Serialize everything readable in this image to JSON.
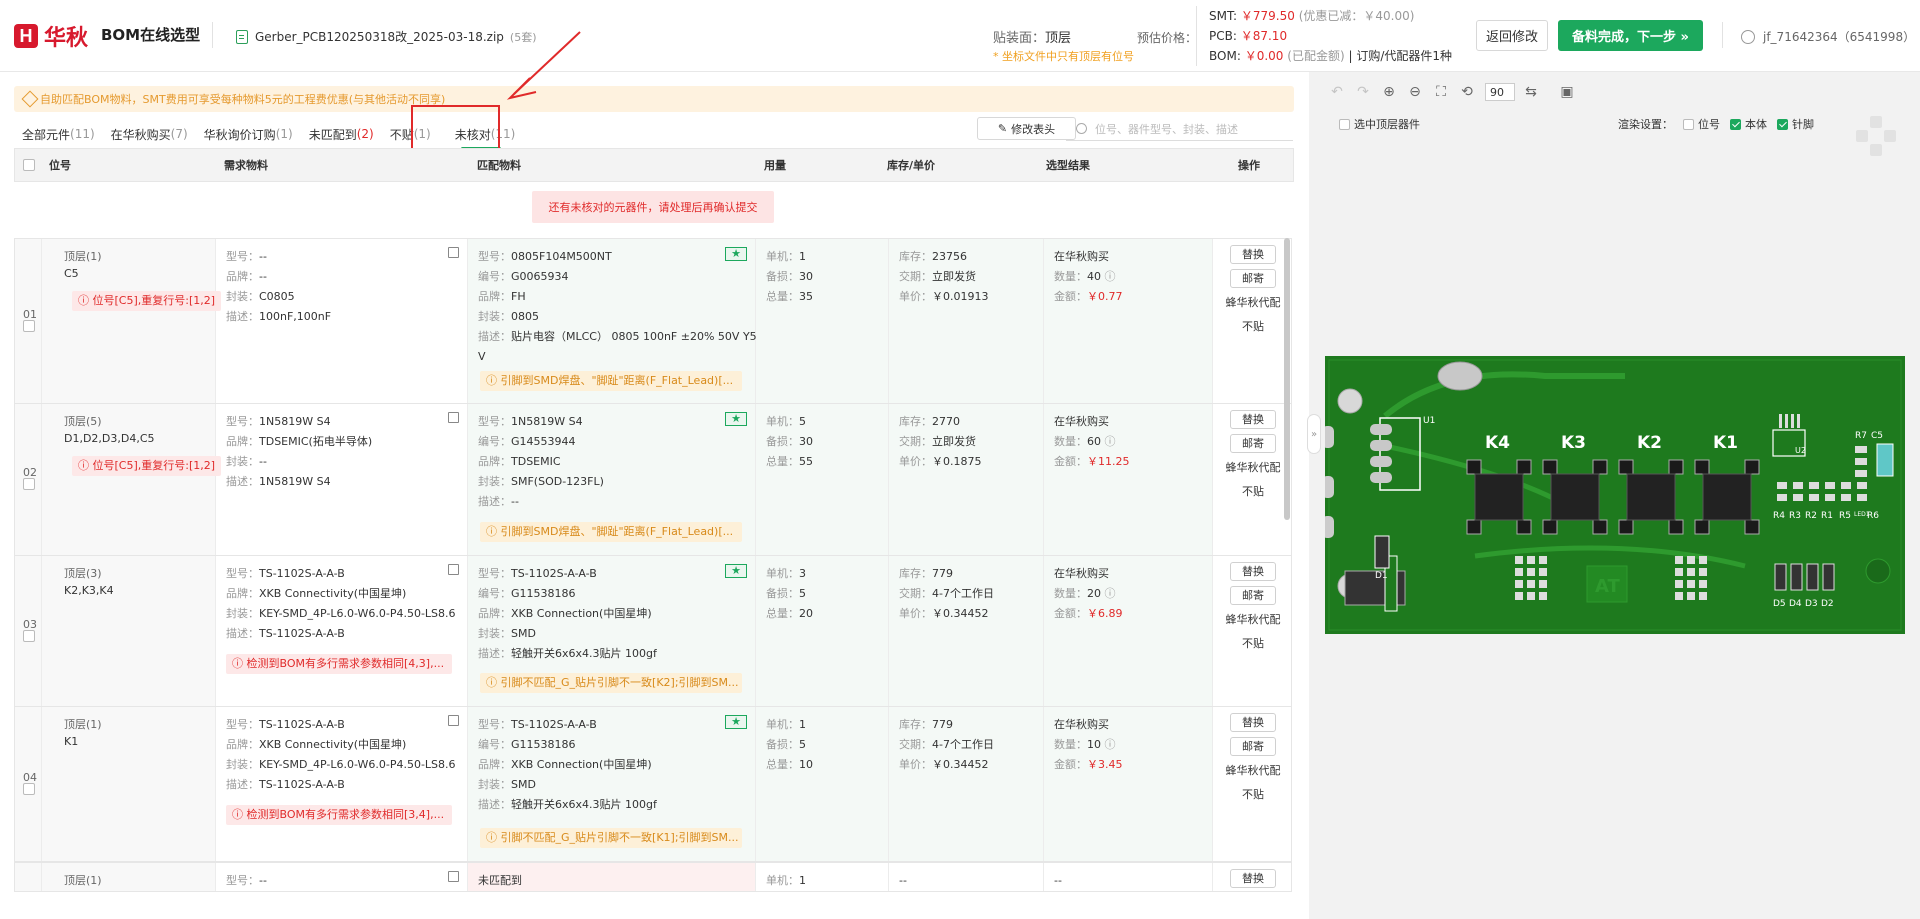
{
  "header": {
    "logo_mark": "H",
    "logo_text": "华秋",
    "app_title": "BOM在线选型",
    "file_name": "Gerber_PCB120250318改_2025-03-18.zip",
    "file_count": "(5套)",
    "side_label": "贴装面：",
    "side_value": "顶层",
    "side_note": "* 坐标文件中只有顶层有位号",
    "estimate_label": "预估价格：",
    "price_smt": "SMT:",
    "price_smt_value": "￥779.50",
    "price_smt_note": "(优惠已减：￥40.00)",
    "price_pcb": "PCB:",
    "price_pcb_value": "￥87.10",
    "price_bom": "BOM:",
    "price_bom_value": "￥0.00",
    "price_bom_note": "(已配金额)",
    "price_bom_extra": "| 订购/代配器件1种",
    "back_button": "返回修改",
    "next_button": "备料完成，下一步 »",
    "user": "jf_71642364（6541998）"
  },
  "notice": "自助匹配BOM物料，SMT费用可享受每种物料5元的工程费优惠(与其他活动不同享)",
  "tabs": [
    {
      "label": "全部元件",
      "count": "(11)"
    },
    {
      "label": "在华秋购买",
      "count": "(7)"
    },
    {
      "label": "华秋询价订购",
      "count": "(1)"
    },
    {
      "label": "未匹配到",
      "count": "(2)"
    },
    {
      "label": "不贴",
      "count": "(1)"
    },
    {
      "label": "未核对",
      "count": "(11)"
    }
  ],
  "edit_header_button": "修改表头",
  "search_placeholder": "位号、器件型号、封装、描述",
  "table_headers": {
    "pos": "位号",
    "req": "需求物料",
    "match": "匹配物料",
    "qty": "用量",
    "stock": "库存/单价",
    "result": "选型结果",
    "op": "操作"
  },
  "unchecked_warning": "还有未核对的元器件，请处理后再确认提交",
  "labels": {
    "model": "型号：",
    "brand": "品牌：",
    "package": "封装：",
    "desc": "描述：",
    "code": "编号：",
    "unit": "单机：",
    "spare": "备损：",
    "total": "总量：",
    "stock": "库存：",
    "lead": "交期：",
    "price": "单价：",
    "count": "数量：",
    "amount": "金额："
  },
  "ops": {
    "replace": "替换",
    "mail": "邮寄",
    "agent": "蜂华秋代配",
    "skip": "不贴"
  },
  "rows": [
    {
      "idx": "01",
      "layer": "顶层(1)",
      "designators": "C5",
      "error": "位号[C5],重复行号:[1,2]",
      "req_model": "--",
      "req_brand": "--",
      "req_package": "C0805",
      "req_desc": "100nF,100nF",
      "m_model": "0805F104M500NT",
      "m_code": "G0065934",
      "m_brand": "FH",
      "m_package": "0805",
      "m_desc": "贴片电容（MLCC） 0805 100nF ±20% 50V Y5",
      "m_desc2": "V",
      "pin_warn": "引脚到SMD焊盘、\"脚趾\"距离(F_Flat_Lead)[...",
      "unit": "1",
      "spare": "30",
      "total": "35",
      "stock": "23756",
      "lead": "立即发货",
      "price": "￥0.01913",
      "result": "在华秋购买",
      "count": "40",
      "amount": "￥0.77"
    },
    {
      "idx": "02",
      "layer": "顶层(5)",
      "designators": "D1,D2,D3,D4,C5",
      "error": "位号[C5],重复行号:[1,2]",
      "req_model": "1N5819W S4",
      "req_brand": "TDSEMIC(拓电半导体)",
      "req_package": "--",
      "req_desc": "1N5819W S4",
      "m_model": "1N5819W S4",
      "m_code": "G14553944",
      "m_brand": "TDSEMIC",
      "m_package": "SMF(SOD-123FL)",
      "m_desc": "--",
      "m_desc2": "",
      "pin_warn": "引脚到SMD焊盘、\"脚趾\"距离(F_Flat_Lead)[...",
      "unit": "5",
      "spare": "30",
      "total": "55",
      "stock": "2770",
      "lead": "立即发货",
      "price": "￥0.1875",
      "result": "在华秋购买",
      "count": "60",
      "amount": "￥11.25"
    },
    {
      "idx": "03",
      "layer": "顶层(3)",
      "designators": "K2,K3,K4",
      "error": "检测到BOM有多行需求参数相同[4,3],...",
      "req_model": "TS-1102S-A-A-B",
      "req_brand": "XKB Connectivity(中国星坤)",
      "req_package": "KEY-SMD_4P-L6.0-W6.0-P4.50-LS8.6",
      "req_desc": "TS-1102S-A-A-B",
      "m_model": "TS-1102S-A-A-B",
      "m_code": "G11538186",
      "m_brand": "XKB Connection(中国星坤)",
      "m_package": "SMD",
      "m_desc": "轻触开关6x6x4.3贴片 100gf",
      "m_desc2": "",
      "pin_warn": "引脚不匹配_G_贴片引脚不一致[K2];引脚到SM...",
      "unit": "3",
      "spare": "5",
      "total": "20",
      "stock": "779",
      "lead": "4-7个工作日",
      "price": "￥0.34452",
      "result": "在华秋购买",
      "count": "20",
      "amount": "￥6.89"
    },
    {
      "idx": "04",
      "layer": "顶层(1)",
      "designators": "K1",
      "error": "检测到BOM有多行需求参数相同[3,4],...",
      "req_model": "TS-1102S-A-A-B",
      "req_brand": "XKB Connectivity(中国星坤)",
      "req_package": "KEY-SMD_4P-L6.0-W6.0-P4.50-LS8.6",
      "req_desc": "TS-1102S-A-A-B",
      "m_model": "TS-1102S-A-A-B",
      "m_code": "G11538186",
      "m_brand": "XKB Connection(中国星坤)",
      "m_package": "SMD",
      "m_desc": "轻触开关6x6x4.3贴片 100gf",
      "m_desc2": "",
      "pin_warn": "引脚不匹配_G_贴片引脚不一致[K1];引脚到SM...",
      "unit": "1",
      "spare": "5",
      "total": "10",
      "stock": "779",
      "lead": "4-7个工作日",
      "price": "￥0.34452",
      "result": "在华秋购买",
      "count": "10",
      "amount": "￥3.45"
    }
  ],
  "row5": {
    "layer": "顶层(1)",
    "req_model": "--",
    "unmatched": "未匹配到",
    "unit": "1",
    "stock": "--",
    "result": "--"
  },
  "viewer": {
    "zoom": "90",
    "top_only": "选中顶层器件",
    "render_label": "渲染设置：",
    "opt_pos": "位号",
    "opt_body": "本体",
    "opt_pin": "针脚"
  },
  "pcb_labels": [
    "K4",
    "K3",
    "K2",
    "K1",
    "U1",
    "U2",
    "R7",
    "C5",
    "R4",
    "R3",
    "R2",
    "R1",
    "R5",
    "LED1",
    "R6",
    "D1",
    "D5",
    "D4",
    "D3",
    "D2",
    "AT"
  ],
  "colors": {
    "brand": "#d7192d",
    "accent": "#1ca85d",
    "error": "#e02a2a",
    "warning": "#e59a2f",
    "pcb": "#1e7a1e"
  }
}
